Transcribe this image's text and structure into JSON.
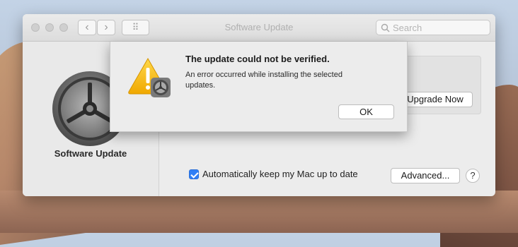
{
  "window": {
    "title": "Software Update"
  },
  "toolbar": {
    "back_icon": "‹",
    "forward_icon": "›",
    "grid_icon": "⠿",
    "search_placeholder": "Search"
  },
  "sidebar": {
    "pane_label": "Software Update"
  },
  "main": {
    "upgrade_button": "Upgrade Now",
    "auto_update_label": "Automatically keep my Mac up to date",
    "auto_update_checked": true,
    "advanced_button": "Advanced...",
    "help_button": "?"
  },
  "alert": {
    "title": "The update could not be verified.",
    "message": "An error occurred while installing the selected updates.",
    "ok_button": "OK"
  },
  "colors": {
    "accent": "#2f7ff6",
    "warning": "#f5b800"
  }
}
